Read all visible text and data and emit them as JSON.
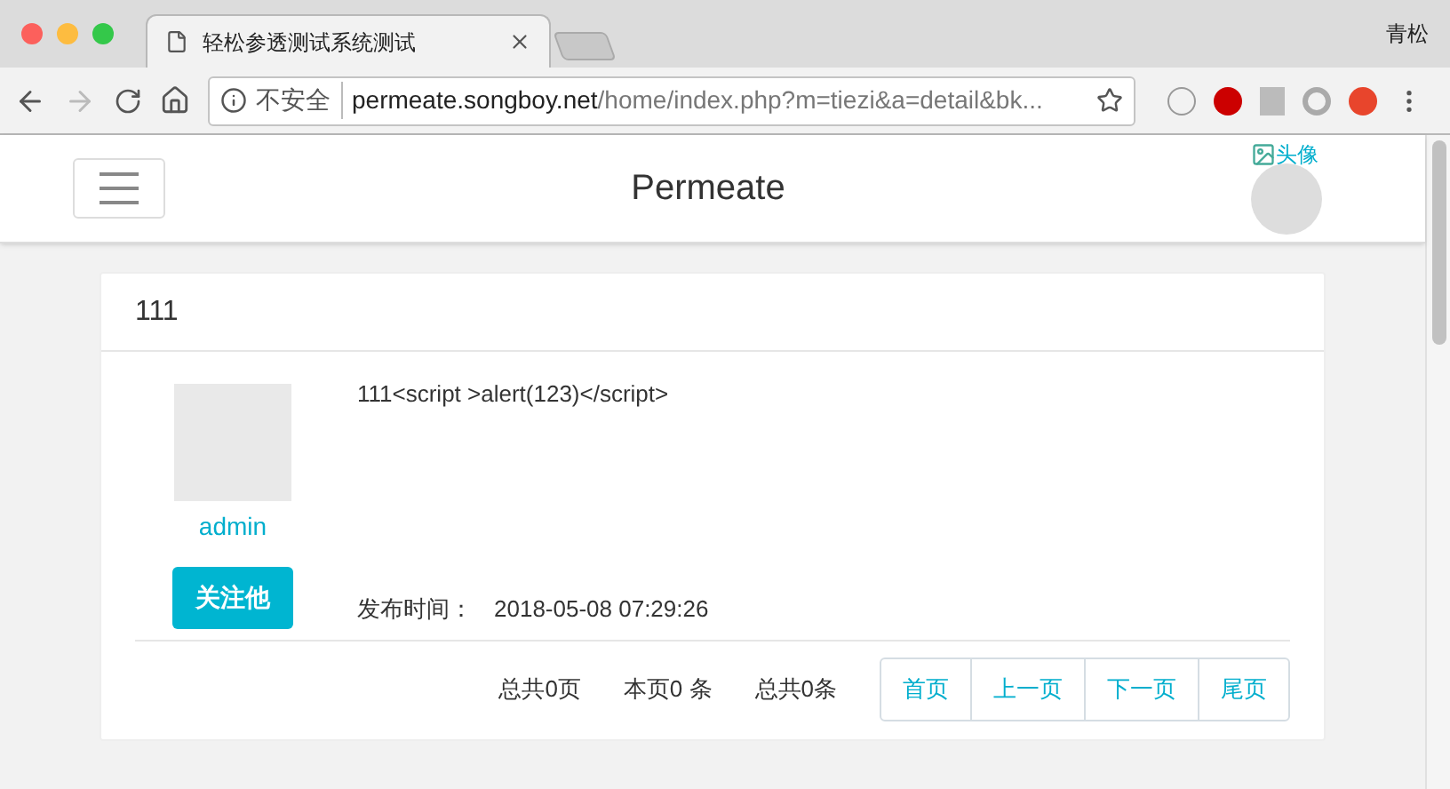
{
  "browser": {
    "tab_title": "轻松参透测试系统测试",
    "profile": "青松",
    "security_label": "不安全",
    "url_domain": "permeate.songboy.net",
    "url_path": "/home/index.php?m=tiezi&a=detail&bk..."
  },
  "navbar": {
    "brand": "Permeate",
    "avatar_alt": "头像"
  },
  "post": {
    "title": "111",
    "author": "admin",
    "follow_button": "关注他",
    "content": "111<script >alert(123)</script>",
    "time_label": "发布时间：",
    "time": "2018-05-08 07:29:26"
  },
  "pagination": {
    "stats": [
      "总共0页",
      "本页0 条",
      "总共0条"
    ],
    "buttons": [
      "首页",
      "上一页",
      "下一页",
      "尾页"
    ]
  }
}
